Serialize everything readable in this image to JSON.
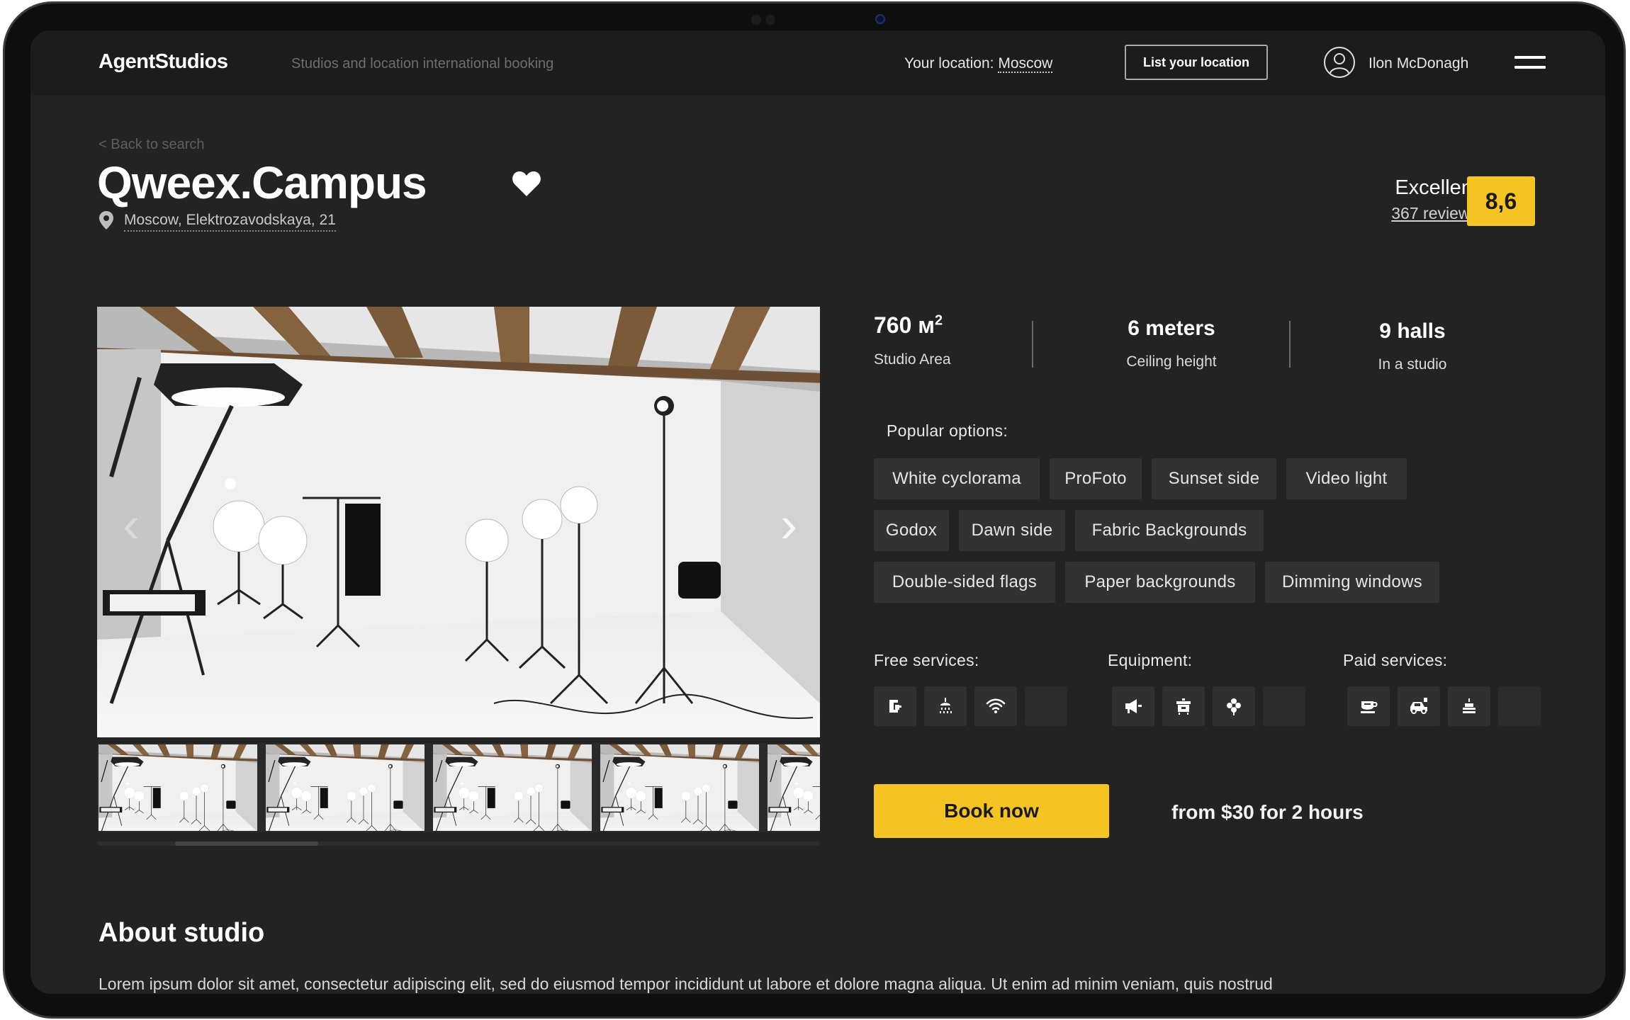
{
  "header": {
    "logo": "AgentStudios",
    "tagline": "Studios and location international booking",
    "location_label": "Your location:",
    "location_city": "Moscow",
    "list_button": "List your location",
    "user_name": "Ilon McDonagh"
  },
  "studio": {
    "back_link": "< Back to search",
    "name": "Qweex.Campus",
    "address": "Moscow, Elektrozavodskaya, 21",
    "rating_label": "Excellent",
    "reviews": "367 reviews",
    "score": "8,6"
  },
  "stats": [
    {
      "value": "760 м",
      "sup": "2",
      "label": "Studio Area"
    },
    {
      "value": "6 meters",
      "label": "Ceiling height"
    },
    {
      "value": "9 halls",
      "label": "In a studio"
    }
  ],
  "options": {
    "title": "Popular options:",
    "items": [
      "White cyclorama",
      "ProFoto",
      "Sunset side",
      "Video light",
      "Godox",
      "Dawn side",
      "Fabric Backgrounds",
      "Double-sided flags",
      "Paper backgrounds",
      "Dimming windows"
    ]
  },
  "services": {
    "free_title": "Free services:",
    "free_icons": [
      "coffee-machine-icon",
      "shower-icon",
      "wifi-icon"
    ],
    "equipment_title": "Equipment:",
    "equipment_icons": [
      "megaphone-icon",
      "grill-icon",
      "flower-icon"
    ],
    "paid_title": "Paid services:",
    "paid_icons": [
      "coffee-cup-icon",
      "car-icon",
      "cake-icon"
    ]
  },
  "booking": {
    "button": "Book now",
    "price": "from $30 for 2 hours"
  },
  "about": {
    "title": "About studio",
    "text": "Lorem ipsum dolor sit amet, consectetur adipiscing elit, sed do eiusmod tempor incididunt ut labore et dolore magna aliqua. Ut enim ad minim veniam, quis nostrud"
  },
  "gallery": {
    "prev": "‹",
    "next": "›",
    "thumbnail_count": 5
  },
  "colors": {
    "accent": "#f5c423",
    "background": "#232323",
    "header": "#1c1c1c",
    "chip": "#323232"
  }
}
